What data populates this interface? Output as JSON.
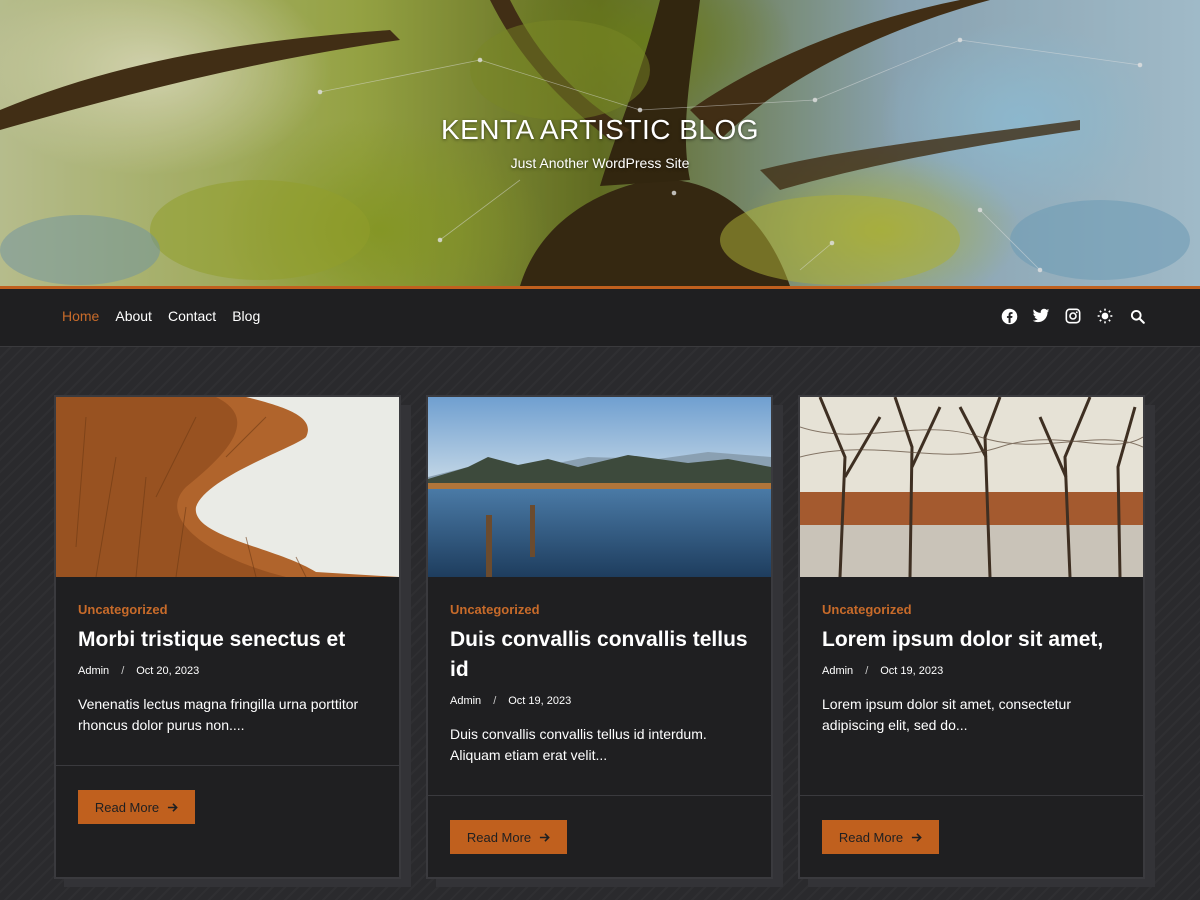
{
  "header": {
    "title": "KENTA ARTISTIC BLOG",
    "tagline": "Just Another WordPress Site"
  },
  "nav": {
    "items": [
      {
        "label": "Home",
        "active": true
      },
      {
        "label": "About",
        "active": false
      },
      {
        "label": "Contact",
        "active": false
      },
      {
        "label": "Blog",
        "active": false
      }
    ],
    "icons": [
      "facebook-icon",
      "twitter-icon",
      "instagram-icon",
      "dark-mode-icon",
      "search-icon"
    ]
  },
  "colors": {
    "accent": "#c0601e",
    "accent_text": "#c86b2a",
    "nav_bg": "#1f1f21",
    "card_bg": "#1f1f21",
    "page_bg": "#2a2a2d"
  },
  "posts": [
    {
      "category": "Uncategorized",
      "title": "Morbi tristique senectus et",
      "author": "Admin",
      "separator": "/",
      "date": "Oct 20, 2023",
      "excerpt": "Venenatis lectus magna fringilla urna porttitor rhoncus dolor purus non....",
      "button": "Read More"
    },
    {
      "category": "Uncategorized",
      "title": "Duis convallis convallis tellus id",
      "author": "Admin",
      "separator": "/",
      "date": "Oct 19, 2023",
      "excerpt": "Duis convallis convallis tellus id interdum. Aliquam etiam erat velit...",
      "button": "Read More"
    },
    {
      "category": "Uncategorized",
      "title": "Lorem ipsum dolor sit amet,",
      "author": "Admin",
      "separator": "/",
      "date": "Oct 19, 2023",
      "excerpt": "Lorem ipsum dolor sit amet, consectetur adipiscing elit, sed do...",
      "button": "Read More"
    }
  ]
}
